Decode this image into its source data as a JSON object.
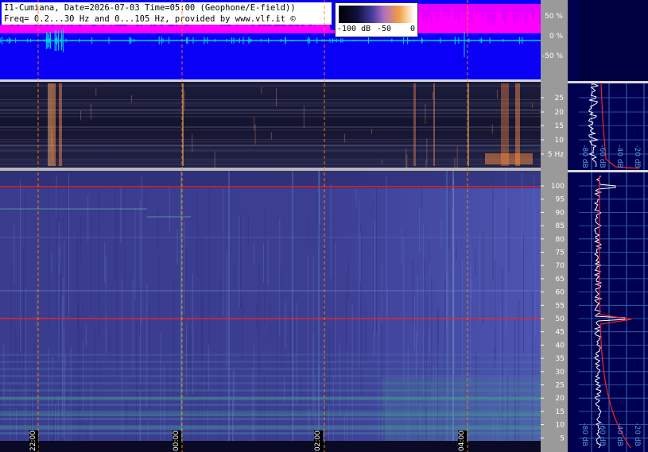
{
  "header": {
    "line1": "I1-Cumiana, Date=2026-07-03 Time=05:00 (Geophone/E-field))",
    "line2": "Freq= 0.2...30 Hz and 0...105 Hz, provided by www.vlf.it ©"
  },
  "colorbar": {
    "labels": [
      "-100 dB",
      "-50",
      "0"
    ]
  },
  "waveform_axis": {
    "ticks": [
      "50 %",
      "0 %",
      "-50 %"
    ]
  },
  "elf_axis": {
    "ticks": [
      "25",
      "20",
      "15",
      "10",
      "5 Hz"
    ]
  },
  "vlf_axis": {
    "ticks": [
      "100",
      "95",
      "90",
      "85",
      "80",
      "75",
      "70",
      "65",
      "60",
      "55",
      "50",
      "45",
      "40",
      "35",
      "30",
      "25",
      "20",
      "15",
      "10",
      "5"
    ]
  },
  "spectrum_top": {
    "db_labels": [
      "-80 dB",
      "-60 dB",
      "-40 dB",
      "-20 dB"
    ]
  },
  "spectrum_bottom": {
    "db_labels": [
      "-80 dB",
      "-60 dB",
      "-40 dB",
      "-20 dB"
    ]
  },
  "time_labels": [
    "22:00",
    "00:00",
    "02:00",
    "04:00"
  ],
  "colors": {
    "waveform_bg": "#0a00f8",
    "waveform_line": "#00d8d8",
    "pink_noise": "#ff00ff",
    "spectrogram_dark": "#0c0c28",
    "spectrogram_blue": "#3c4aa0",
    "spectrum_bg": "#000050",
    "marker": "#ff8800",
    "mains_line": "#ff2020"
  }
}
